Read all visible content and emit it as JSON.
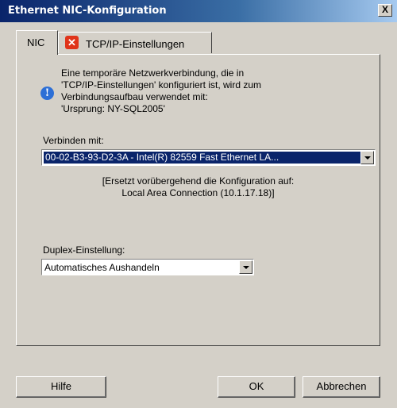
{
  "window": {
    "title": "Ethernet NIC-Konfiguration",
    "close_label": "X"
  },
  "tabs": [
    {
      "label": "NIC",
      "active": true
    },
    {
      "label": "TCP/IP-Einstellungen",
      "active": false,
      "icon": "error-icon"
    }
  ],
  "info": {
    "icon": "info-icon",
    "lines": [
      "Eine temporäre Netzwerkverbindung, die in",
      "'TCP/IP-Einstellungen' konfiguriert ist, wird zum",
      "Verbindungsaufbau verwendet mit:",
      "'Ursprung: NY-SQL2005'"
    ]
  },
  "connect": {
    "label": "Verbinden mit:",
    "value": "00-02-B3-93-D2-3A  -  Intel(R)  82559  Fast  Ethernet  LA..."
  },
  "note": {
    "line1": "[Ersetzt vorübergehend die Konfiguration auf:",
    "line2": "Local Area Connection (10.1.17.18)]"
  },
  "duplex": {
    "label": "Duplex-Einstellung:",
    "value": "Automatisches Aushandeln"
  },
  "buttons": {
    "help": "Hilfe",
    "ok": "OK",
    "cancel": "Abbrechen"
  },
  "colors": {
    "titlebar_start": "#0a246a",
    "face": "#d4d0c8",
    "selection": "#0a246a"
  }
}
